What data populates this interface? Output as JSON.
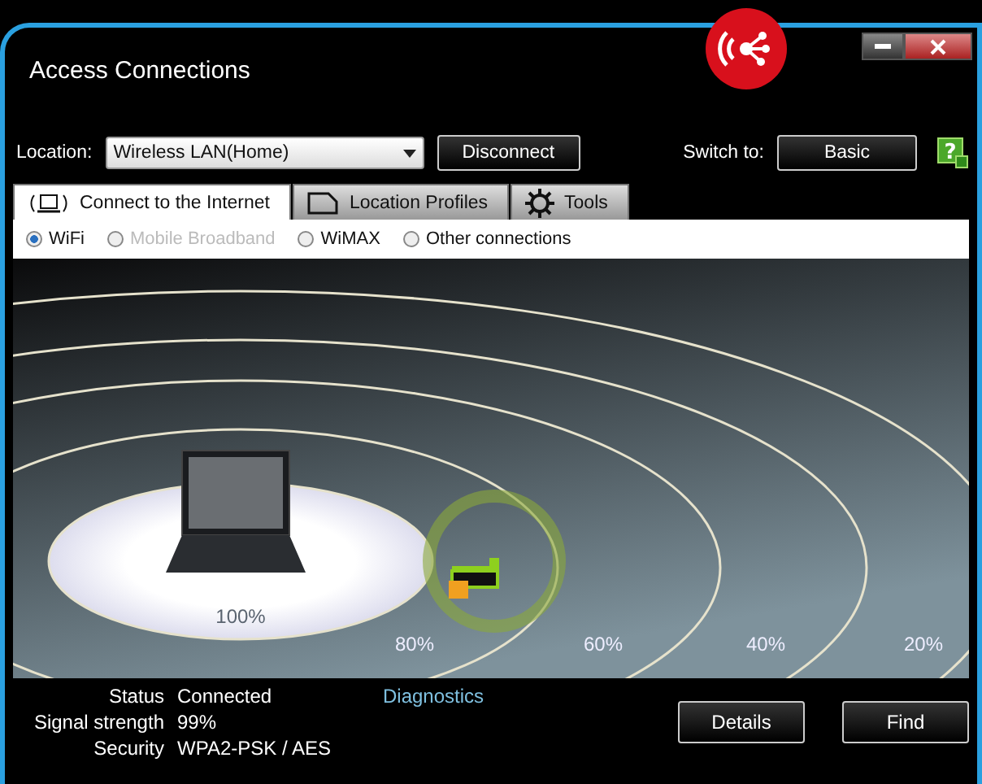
{
  "window": {
    "title": "Access Connections"
  },
  "location": {
    "label": "Location:",
    "value": "Wireless LAN(Home)"
  },
  "connect_button": "Disconnect",
  "switch_to": {
    "label": "Switch to:",
    "button": "Basic"
  },
  "help_button": "?",
  "tabs": [
    {
      "label": "Connect to the Internet",
      "selected": true,
      "kind": "laptop"
    },
    {
      "label": "Location Profiles",
      "selected": false,
      "kind": "profile"
    },
    {
      "label": "Tools",
      "selected": false,
      "kind": "gear"
    }
  ],
  "connection_types": [
    {
      "label": "WiFi",
      "selected": true,
      "disabled": false
    },
    {
      "label": "Mobile Broadband",
      "selected": false,
      "disabled": true
    },
    {
      "label": "WiMAX",
      "selected": false,
      "disabled": false
    },
    {
      "label": "Other connections",
      "selected": false,
      "disabled": false
    }
  ],
  "signal_rings": [
    "100%",
    "80%",
    "60%",
    "40%",
    "20%"
  ],
  "status": [
    {
      "label": "Status",
      "value": "Connected"
    },
    {
      "label": "Signal strength",
      "value": "99%"
    },
    {
      "label": "Security",
      "value": "WPA2-PSK / AES"
    }
  ],
  "diagnostics_link": "Diagnostics",
  "buttons": [
    "Details",
    "Find"
  ]
}
